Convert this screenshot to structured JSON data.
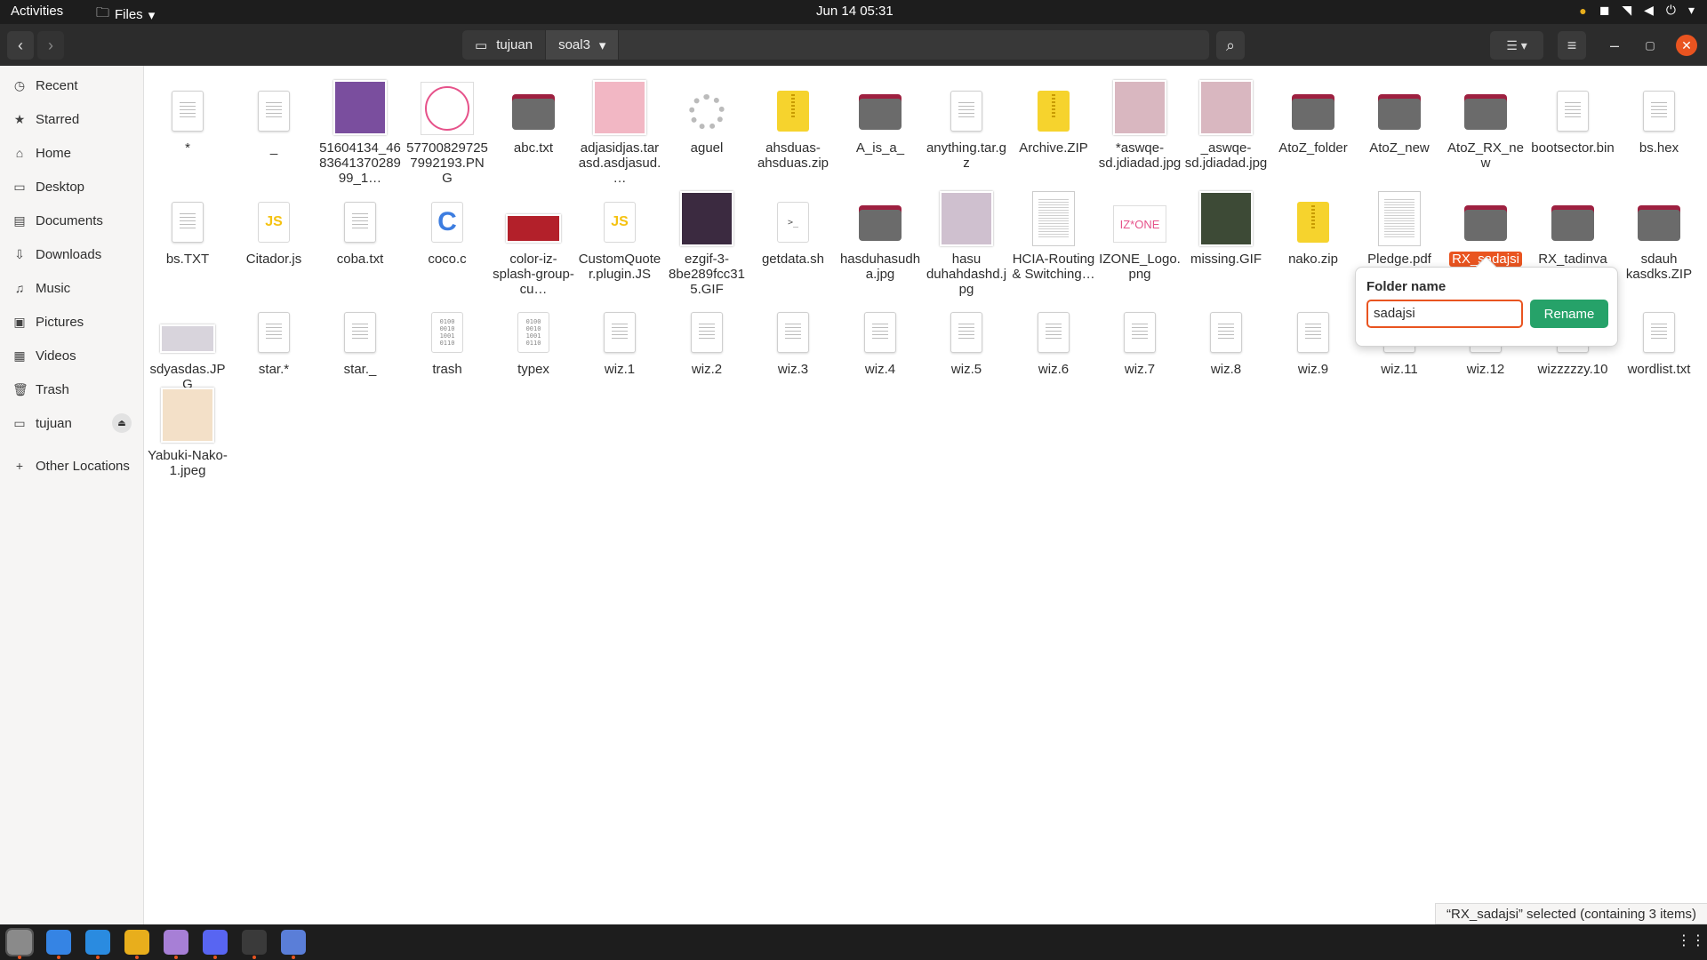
{
  "topbar": {
    "activities": "Activities",
    "app_menu": "Files",
    "clock": "Jun 14  05:31"
  },
  "pathbar": {
    "home": "tujuan",
    "current": "soal3"
  },
  "sidebar": {
    "items": [
      {
        "label": "Recent",
        "icon": "clock-icon"
      },
      {
        "label": "Starred",
        "icon": "star-icon"
      },
      {
        "label": "Home",
        "icon": "home-icon"
      },
      {
        "label": "Desktop",
        "icon": "desktop-icon"
      },
      {
        "label": "Documents",
        "icon": "document-icon"
      },
      {
        "label": "Downloads",
        "icon": "download-icon"
      },
      {
        "label": "Music",
        "icon": "music-icon"
      },
      {
        "label": "Pictures",
        "icon": "picture-icon"
      },
      {
        "label": "Videos",
        "icon": "video-icon"
      },
      {
        "label": "Trash",
        "icon": "trash-icon"
      },
      {
        "label": "tujuan",
        "icon": "drive-icon"
      },
      {
        "label": "Other Locations",
        "icon": "plus-icon"
      }
    ]
  },
  "files": [
    {
      "name": "*",
      "kind": "doc"
    },
    {
      "name": "_",
      "kind": "doc"
    },
    {
      "name": "51604134_468364137028999_1…",
      "kind": "photo",
      "color": "#7a4e9e"
    },
    {
      "name": "577008297257992193.PNG",
      "kind": "circlepic"
    },
    {
      "name": "abc.txt",
      "kind": "folder"
    },
    {
      "name": "adjasidjas.tarasd.asdjasud.…",
      "kind": "photo",
      "color": "#f2b7c4"
    },
    {
      "name": "aguel",
      "kind": "gear"
    },
    {
      "name": "ahsduas-ahsduas.zip",
      "kind": "zip"
    },
    {
      "name": "A_is_a_",
      "kind": "folder"
    },
    {
      "name": "anything.tar.gz",
      "kind": "doc"
    },
    {
      "name": "Archive.ZIP",
      "kind": "zip"
    },
    {
      "name": "*aswqe-sd.jdiadad.jpg",
      "kind": "photo",
      "color": "#d9b7c0"
    },
    {
      "name": "_aswqe-sd.jdiadad.jpg",
      "kind": "photo",
      "color": "#d9b7c0"
    },
    {
      "name": "AtoZ_folder",
      "kind": "folder"
    },
    {
      "name": "AtoZ_new",
      "kind": "folder"
    },
    {
      "name": "AtoZ_RX_new",
      "kind": "folder"
    },
    {
      "name": "bootsector.bin",
      "kind": "doc"
    },
    {
      "name": "bs.hex",
      "kind": "doc"
    },
    {
      "name": "bs.TXT",
      "kind": "doc"
    },
    {
      "name": "Citador.js",
      "kind": "js"
    },
    {
      "name": "coba.txt",
      "kind": "doc"
    },
    {
      "name": "coco.c",
      "kind": "csrc"
    },
    {
      "name": "color-iz-splash-group-cu…",
      "kind": "wide",
      "color": "#b3202a"
    },
    {
      "name": "CustomQuoter.plugin.JS",
      "kind": "js"
    },
    {
      "name": "ezgif-3-8be289fcc315.GIF",
      "kind": "photo",
      "color": "#3b2a40"
    },
    {
      "name": "getdata.sh",
      "kind": "sh"
    },
    {
      "name": "hasduhasudha.jpg",
      "kind": "folder"
    },
    {
      "name": "hasu duhahdashd.jpg",
      "kind": "photo",
      "color": "#cfc0cf"
    },
    {
      "name": "HCIA-Routing & Switching…",
      "kind": "pdf"
    },
    {
      "name": "IZONE_Logo.png",
      "kind": "logo"
    },
    {
      "name": "missing.GIF",
      "kind": "photo",
      "color": "#3d4a36"
    },
    {
      "name": "nako.zip",
      "kind": "zip"
    },
    {
      "name": "Pledge.pdf",
      "kind": "pdf"
    },
    {
      "name": "RX_sadajsi",
      "kind": "folder",
      "selected": true
    },
    {
      "name": "RX_tadinva",
      "kind": "folder"
    },
    {
      "name": "sdauh kasdks.ZIP",
      "kind": "folder"
    },
    {
      "name": "sdyasdas.JPG",
      "kind": "wide",
      "color": "#d8d4dc"
    },
    {
      "name": "star.*",
      "kind": "doc"
    },
    {
      "name": "star._",
      "kind": "doc"
    },
    {
      "name": "trash",
      "kind": "bin"
    },
    {
      "name": "typex",
      "kind": "bin"
    },
    {
      "name": "wiz.1",
      "kind": "doc"
    },
    {
      "name": "wiz.2",
      "kind": "doc"
    },
    {
      "name": "wiz.3",
      "kind": "doc"
    },
    {
      "name": "wiz.4",
      "kind": "doc"
    },
    {
      "name": "wiz.5",
      "kind": "doc"
    },
    {
      "name": "wiz.6",
      "kind": "doc"
    },
    {
      "name": "wiz.7",
      "kind": "doc"
    },
    {
      "name": "wiz.8",
      "kind": "doc"
    },
    {
      "name": "wiz.9",
      "kind": "doc"
    },
    {
      "name": "wiz.11",
      "kind": "doc"
    },
    {
      "name": "wiz.12",
      "kind": "doc"
    },
    {
      "name": "wizzzzzy.10",
      "kind": "doc"
    },
    {
      "name": "wordlist.txt",
      "kind": "doc"
    },
    {
      "name": "Yabuki-Nako-1.jpeg",
      "kind": "photo",
      "color": "#f3e0c8"
    }
  ],
  "rename": {
    "title": "Folder name",
    "value": "sadajsi",
    "button": "Rename"
  },
  "status": "“RX_sadajsi” selected  (containing 3 items)",
  "dock": [
    {
      "icon": "files-icon",
      "color": "#8a8a8a"
    },
    {
      "icon": "text-editor-icon",
      "color": "#3584e4"
    },
    {
      "icon": "vscode-icon",
      "color": "#2a8be0"
    },
    {
      "icon": "chrome-icon",
      "color": "#e8ae1c"
    },
    {
      "icon": "github-icon",
      "color": "#a77fd6"
    },
    {
      "icon": "discord-icon",
      "color": "#5865f2"
    },
    {
      "icon": "terminal-icon",
      "color": "#3a3a3a"
    },
    {
      "icon": "notes-icon",
      "color": "#5a7ed8"
    }
  ]
}
